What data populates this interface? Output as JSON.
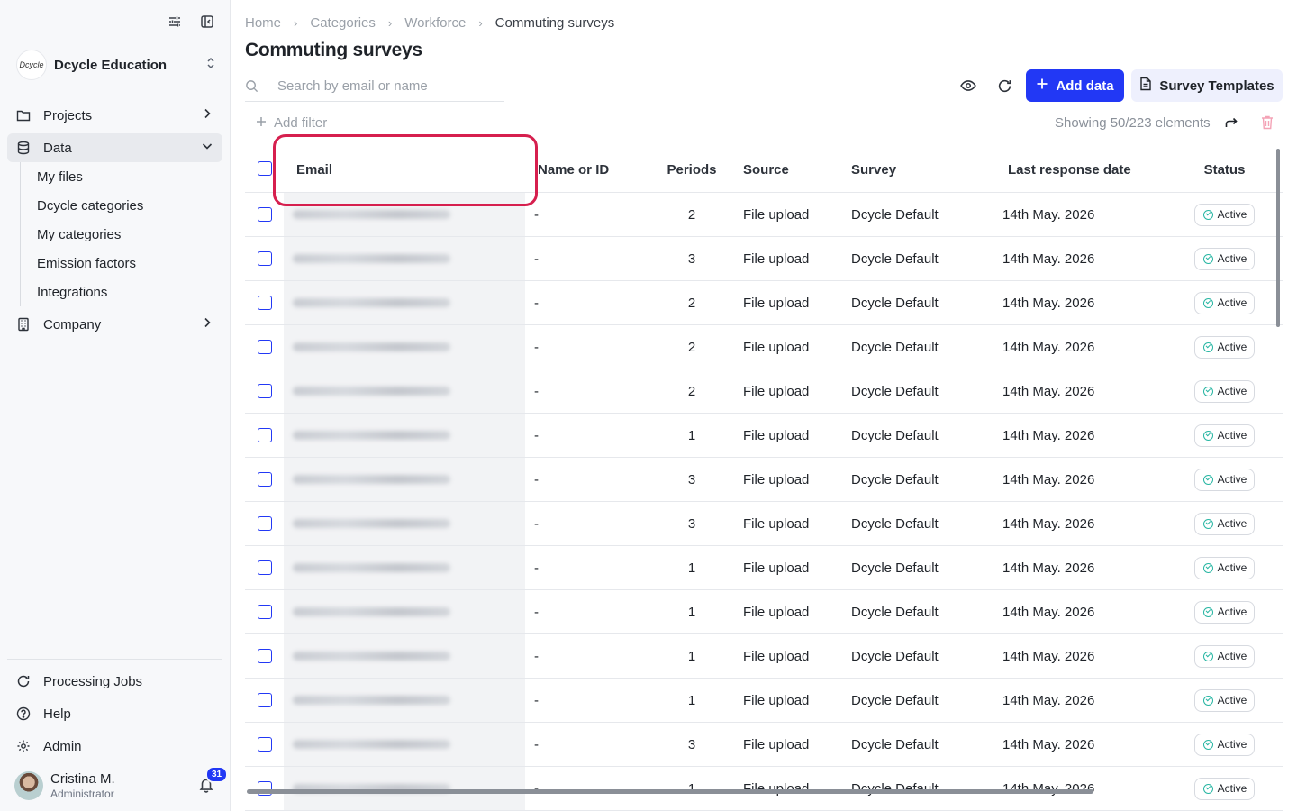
{
  "sidebar": {
    "org_logo_text": "Dcycle",
    "org_name": "Dcycle Education",
    "nav": {
      "projects": "Projects",
      "data": "Data",
      "company": "Company"
    },
    "sub_items": [
      "My files",
      "Dcycle categories",
      "My categories",
      "Emission factors",
      "Integrations"
    ],
    "bottom": {
      "processing_jobs": "Processing Jobs",
      "help": "Help",
      "admin": "Admin"
    },
    "user": {
      "name": "Cristina M.",
      "role": "Administrator",
      "notifications": "31"
    }
  },
  "breadcrumb": [
    "Home",
    "Categories",
    "Workforce",
    "Commuting surveys"
  ],
  "page_title": "Commuting surveys",
  "search": {
    "placeholder": "Search by email or name"
  },
  "toolbar": {
    "add_data": "Add data",
    "survey_templates": "Survey Templates",
    "add_filter": "Add filter",
    "showing": "Showing 50/223 elements"
  },
  "table": {
    "headers": {
      "email": "Email",
      "name": "Name or ID",
      "periods": "Periods",
      "source": "Source",
      "survey": "Survey",
      "last_response": "Last response date",
      "status": "Status"
    },
    "rows": [
      {
        "name": "-",
        "periods": "2",
        "source": "File upload",
        "survey": "Dcycle Default",
        "date": "14th May. 2026",
        "status": "Active"
      },
      {
        "name": "-",
        "periods": "3",
        "source": "File upload",
        "survey": "Dcycle Default",
        "date": "14th May. 2026",
        "status": "Active"
      },
      {
        "name": "-",
        "periods": "2",
        "source": "File upload",
        "survey": "Dcycle Default",
        "date": "14th May. 2026",
        "status": "Active"
      },
      {
        "name": "-",
        "periods": "2",
        "source": "File upload",
        "survey": "Dcycle Default",
        "date": "14th May. 2026",
        "status": "Active"
      },
      {
        "name": "-",
        "periods": "2",
        "source": "File upload",
        "survey": "Dcycle Default",
        "date": "14th May. 2026",
        "status": "Active"
      },
      {
        "name": "-",
        "periods": "1",
        "source": "File upload",
        "survey": "Dcycle Default",
        "date": "14th May. 2026",
        "status": "Active"
      },
      {
        "name": "-",
        "periods": "3",
        "source": "File upload",
        "survey": "Dcycle Default",
        "date": "14th May. 2026",
        "status": "Active"
      },
      {
        "name": "-",
        "periods": "3",
        "source": "File upload",
        "survey": "Dcycle Default",
        "date": "14th May. 2026",
        "status": "Active"
      },
      {
        "name": "-",
        "periods": "1",
        "source": "File upload",
        "survey": "Dcycle Default",
        "date": "14th May. 2026",
        "status": "Active"
      },
      {
        "name": "-",
        "periods": "1",
        "source": "File upload",
        "survey": "Dcycle Default",
        "date": "14th May. 2026",
        "status": "Active"
      },
      {
        "name": "-",
        "periods": "1",
        "source": "File upload",
        "survey": "Dcycle Default",
        "date": "14th May. 2026",
        "status": "Active"
      },
      {
        "name": "-",
        "periods": "1",
        "source": "File upload",
        "survey": "Dcycle Default",
        "date": "14th May. 2026",
        "status": "Active"
      },
      {
        "name": "-",
        "periods": "3",
        "source": "File upload",
        "survey": "Dcycle Default",
        "date": "14th May. 2026",
        "status": "Active"
      },
      {
        "name": "-",
        "periods": "1",
        "source": "File upload",
        "survey": "Dcycle Default",
        "date": "14th May. 2026",
        "status": "Active"
      }
    ]
  },
  "colors": {
    "primary": "#2238f5",
    "highlight": "#d61f4e",
    "status_active": "#28b6a3"
  }
}
